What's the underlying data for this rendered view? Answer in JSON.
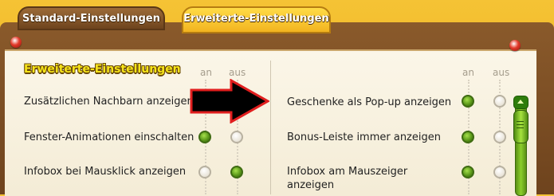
{
  "tabs": [
    {
      "label": "Standard-Einstellungen",
      "active": false
    },
    {
      "label": "Erweiterte-Einstellungen",
      "active": true
    }
  ],
  "section_title": "Erweiterte-Einstellungen",
  "columns": {
    "on": "an",
    "off": "aus"
  },
  "left_options": [
    {
      "label": "Zusätzlichen Nachbarn anzeigen",
      "state": "on"
    },
    {
      "label": "Fenster-Animationen einschalten",
      "state": "on"
    },
    {
      "label": "Infobox bei Mausklick anzeigen",
      "state": "off"
    }
  ],
  "right_options": [
    {
      "label": "Geschenke als Pop-up anzeigen",
      "state": "on"
    },
    {
      "label": "Bonus-Leiste immer anzeigen",
      "state": "on"
    },
    {
      "label_line1": "Infobox am Mauszeiger",
      "label_line2": "anzeigen",
      "state": "on"
    }
  ],
  "annotation": {
    "type": "arrow",
    "color": "#e01e1e",
    "points_to": "right_options.0"
  }
}
